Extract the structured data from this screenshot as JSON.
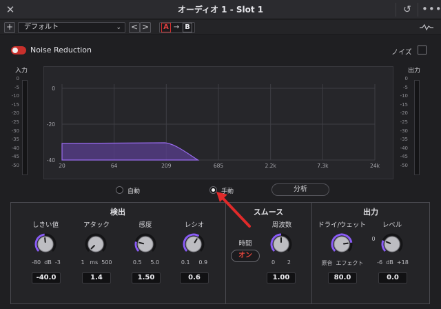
{
  "titlebar": {
    "title": "オーディオ 1 - Slot 1",
    "close_icon": "close-icon",
    "reset_icon": "reset-icon",
    "more_icon": "more-icon"
  },
  "presetbar": {
    "add_label": "+",
    "preset_value": "デフォルト",
    "prev_label": "<",
    "next_label": ">",
    "a_label": "A",
    "arrow_label": "→",
    "b_label": "B"
  },
  "header": {
    "plugin_name": "Noise Reduction",
    "enabled": true,
    "noise_label": "ノイズ"
  },
  "meters": {
    "input_label": "入力",
    "output_label": "出力",
    "ticks": [
      "0",
      "-5",
      "-10",
      "-15",
      "-20",
      "-25",
      "-30",
      "-35",
      "-40",
      "-45",
      "-50"
    ]
  },
  "graph": {
    "y_ticks": [
      "0",
      "-20",
      "-40"
    ],
    "x_ticks": [
      "20",
      "64",
      "209",
      "685",
      "2.2k",
      "7.3k",
      "24k"
    ]
  },
  "mode": {
    "auto_label": "自動",
    "manual_label": "手動",
    "selected": "manual",
    "analyze_label": "分析"
  },
  "detect": {
    "title": "検出",
    "threshold": {
      "label": "しきい値",
      "min": "-80",
      "unit": "dB",
      "max": "-3",
      "value": "-40.0",
      "level": 0.48
    },
    "attack": {
      "label": "アタック",
      "min": "1",
      "unit": "ms",
      "max": "500",
      "value": "1.4",
      "level": 0.0
    },
    "ratio_db": {
      "label": "感度",
      "min": "0.5",
      "max": "5.0",
      "value": "1.50",
      "level": 0.22
    },
    "ratio": {
      "label": "レシオ",
      "min": "0.1",
      "max": "0.9",
      "value": "0.6",
      "level": 0.62
    }
  },
  "smooth": {
    "title": "スムース",
    "time_label": "時間",
    "time_button": "オン",
    "freq": {
      "label": "周波数",
      "min": "0",
      "max": "2",
      "value": "1.00",
      "level": 0.5
    }
  },
  "output": {
    "title": "出力",
    "drywet": {
      "label": "ドライ/ウェット",
      "min": "原音",
      "max": "エフェクト",
      "value": "80.0",
      "level": 0.8
    },
    "level": {
      "label": "レベル",
      "zero": "0",
      "min": "-6",
      "unit": "dB",
      "max": "+18",
      "value": "0.0",
      "level": 0.25
    }
  },
  "colors": {
    "accent": "#8a5cf6",
    "curve_fill": "#5a3f8f",
    "toggle": "#c8302c",
    "annotation": "#e02a2a"
  }
}
